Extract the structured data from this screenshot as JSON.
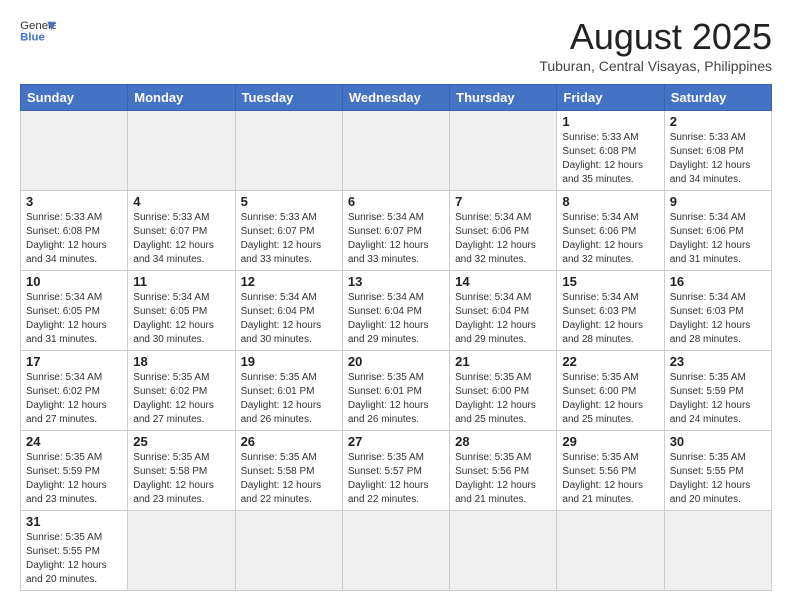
{
  "header": {
    "logo_general": "General",
    "logo_blue": "Blue",
    "month_title": "August 2025",
    "subtitle": "Tuburan, Central Visayas, Philippines"
  },
  "weekdays": [
    "Sunday",
    "Monday",
    "Tuesday",
    "Wednesday",
    "Thursday",
    "Friday",
    "Saturday"
  ],
  "weeks": [
    [
      {
        "day": "",
        "info": "",
        "empty": true
      },
      {
        "day": "",
        "info": "",
        "empty": true
      },
      {
        "day": "",
        "info": "",
        "empty": true
      },
      {
        "day": "",
        "info": "",
        "empty": true
      },
      {
        "day": "",
        "info": "",
        "empty": true
      },
      {
        "day": "1",
        "info": "Sunrise: 5:33 AM\nSunset: 6:08 PM\nDaylight: 12 hours\nand 35 minutes."
      },
      {
        "day": "2",
        "info": "Sunrise: 5:33 AM\nSunset: 6:08 PM\nDaylight: 12 hours\nand 34 minutes."
      }
    ],
    [
      {
        "day": "3",
        "info": "Sunrise: 5:33 AM\nSunset: 6:08 PM\nDaylight: 12 hours\nand 34 minutes."
      },
      {
        "day": "4",
        "info": "Sunrise: 5:33 AM\nSunset: 6:07 PM\nDaylight: 12 hours\nand 34 minutes."
      },
      {
        "day": "5",
        "info": "Sunrise: 5:33 AM\nSunset: 6:07 PM\nDaylight: 12 hours\nand 33 minutes."
      },
      {
        "day": "6",
        "info": "Sunrise: 5:34 AM\nSunset: 6:07 PM\nDaylight: 12 hours\nand 33 minutes."
      },
      {
        "day": "7",
        "info": "Sunrise: 5:34 AM\nSunset: 6:06 PM\nDaylight: 12 hours\nand 32 minutes."
      },
      {
        "day": "8",
        "info": "Sunrise: 5:34 AM\nSunset: 6:06 PM\nDaylight: 12 hours\nand 32 minutes."
      },
      {
        "day": "9",
        "info": "Sunrise: 5:34 AM\nSunset: 6:06 PM\nDaylight: 12 hours\nand 31 minutes."
      }
    ],
    [
      {
        "day": "10",
        "info": "Sunrise: 5:34 AM\nSunset: 6:05 PM\nDaylight: 12 hours\nand 31 minutes."
      },
      {
        "day": "11",
        "info": "Sunrise: 5:34 AM\nSunset: 6:05 PM\nDaylight: 12 hours\nand 30 minutes."
      },
      {
        "day": "12",
        "info": "Sunrise: 5:34 AM\nSunset: 6:04 PM\nDaylight: 12 hours\nand 30 minutes."
      },
      {
        "day": "13",
        "info": "Sunrise: 5:34 AM\nSunset: 6:04 PM\nDaylight: 12 hours\nand 29 minutes."
      },
      {
        "day": "14",
        "info": "Sunrise: 5:34 AM\nSunset: 6:04 PM\nDaylight: 12 hours\nand 29 minutes."
      },
      {
        "day": "15",
        "info": "Sunrise: 5:34 AM\nSunset: 6:03 PM\nDaylight: 12 hours\nand 28 minutes."
      },
      {
        "day": "16",
        "info": "Sunrise: 5:34 AM\nSunset: 6:03 PM\nDaylight: 12 hours\nand 28 minutes."
      }
    ],
    [
      {
        "day": "17",
        "info": "Sunrise: 5:34 AM\nSunset: 6:02 PM\nDaylight: 12 hours\nand 27 minutes."
      },
      {
        "day": "18",
        "info": "Sunrise: 5:35 AM\nSunset: 6:02 PM\nDaylight: 12 hours\nand 27 minutes."
      },
      {
        "day": "19",
        "info": "Sunrise: 5:35 AM\nSunset: 6:01 PM\nDaylight: 12 hours\nand 26 minutes."
      },
      {
        "day": "20",
        "info": "Sunrise: 5:35 AM\nSunset: 6:01 PM\nDaylight: 12 hours\nand 26 minutes."
      },
      {
        "day": "21",
        "info": "Sunrise: 5:35 AM\nSunset: 6:00 PM\nDaylight: 12 hours\nand 25 minutes."
      },
      {
        "day": "22",
        "info": "Sunrise: 5:35 AM\nSunset: 6:00 PM\nDaylight: 12 hours\nand 25 minutes."
      },
      {
        "day": "23",
        "info": "Sunrise: 5:35 AM\nSunset: 5:59 PM\nDaylight: 12 hours\nand 24 minutes."
      }
    ],
    [
      {
        "day": "24",
        "info": "Sunrise: 5:35 AM\nSunset: 5:59 PM\nDaylight: 12 hours\nand 23 minutes."
      },
      {
        "day": "25",
        "info": "Sunrise: 5:35 AM\nSunset: 5:58 PM\nDaylight: 12 hours\nand 23 minutes."
      },
      {
        "day": "26",
        "info": "Sunrise: 5:35 AM\nSunset: 5:58 PM\nDaylight: 12 hours\nand 22 minutes."
      },
      {
        "day": "27",
        "info": "Sunrise: 5:35 AM\nSunset: 5:57 PM\nDaylight: 12 hours\nand 22 minutes."
      },
      {
        "day": "28",
        "info": "Sunrise: 5:35 AM\nSunset: 5:56 PM\nDaylight: 12 hours\nand 21 minutes."
      },
      {
        "day": "29",
        "info": "Sunrise: 5:35 AM\nSunset: 5:56 PM\nDaylight: 12 hours\nand 21 minutes."
      },
      {
        "day": "30",
        "info": "Sunrise: 5:35 AM\nSunset: 5:55 PM\nDaylight: 12 hours\nand 20 minutes."
      }
    ],
    [
      {
        "day": "31",
        "info": "Sunrise: 5:35 AM\nSunset: 5:55 PM\nDaylight: 12 hours\nand 20 minutes.",
        "last": true
      },
      {
        "day": "",
        "info": "",
        "empty": true,
        "last": true
      },
      {
        "day": "",
        "info": "",
        "empty": true,
        "last": true
      },
      {
        "day": "",
        "info": "",
        "empty": true,
        "last": true
      },
      {
        "day": "",
        "info": "",
        "empty": true,
        "last": true
      },
      {
        "day": "",
        "info": "",
        "empty": true,
        "last": true
      },
      {
        "day": "",
        "info": "",
        "empty": true,
        "last": true
      }
    ]
  ]
}
